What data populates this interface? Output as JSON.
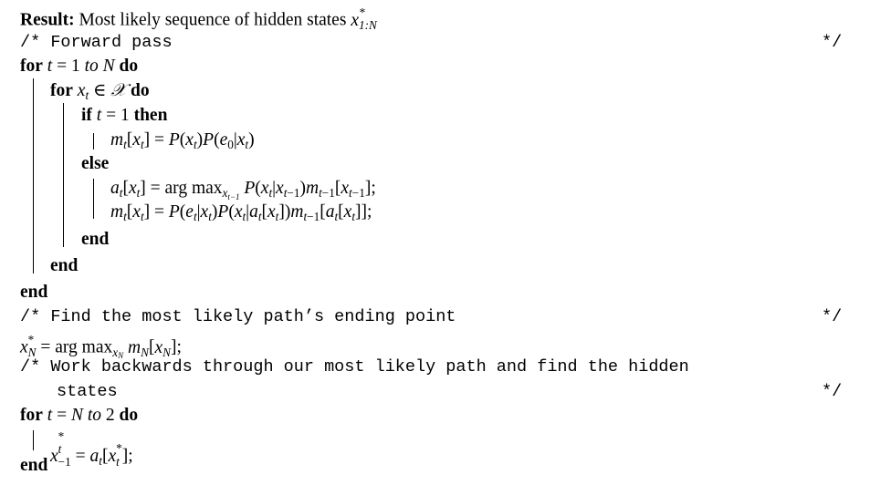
{
  "algorithm": {
    "result_label": "Result:",
    "result_text": "Most likely sequence of hidden states",
    "result_math": {
      "base": "x",
      "sup": "*",
      "sub": "1:N"
    },
    "comment_open": "/*",
    "comment_close": "*/",
    "comments": {
      "forward": "Forward pass",
      "find_end": "Find the most likely path’s ending point",
      "backward_1": "Work backwards through our most likely path and find the hidden",
      "backward_2": "states"
    },
    "keywords": {
      "for": "for",
      "do": "do",
      "if": "if",
      "then": "then",
      "else": "else",
      "end": "end"
    },
    "loop1": {
      "var": "t",
      "rel": "=",
      "start": "1",
      "to": "to",
      "stop": "N"
    },
    "loop2": {
      "var": "x",
      "var_sub": "t",
      "rel": "∈",
      "set": "𝒳"
    },
    "cond": {
      "var": "t",
      "rel": "=",
      "value": "1"
    },
    "stmt_init": "m_t[x_t] = P(x_t)P(e_0|x_t)",
    "stmt_a": "a_t[x_t] = arg max_{x_{t−1}} P(x_t|x_{t−1})m_{t−1}[x_{t−1}];",
    "stmt_m": "m_t[x_t] = P(e_t|x_t)P(x_t|a_t[x_t])m_{t−1}[a_t[x_t]];",
    "stmt_xn": "x*_N = arg max_{x_N} m_N[x_N];",
    "loop3": {
      "var": "t",
      "rel": "=",
      "start": "N",
      "to": "to",
      "stop": "2"
    },
    "stmt_back": "x*_{t−1} = a_t[x*_t];"
  }
}
